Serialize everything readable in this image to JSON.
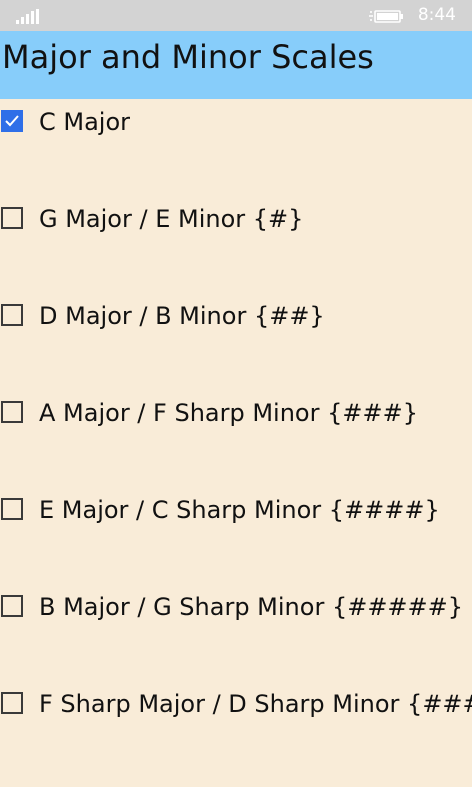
{
  "status_bar": {
    "time": "8:44",
    "signal_icon": "signal-strength-icon",
    "battery_icon": "battery-charging-icon"
  },
  "header": {
    "title": "Major and Minor Scales"
  },
  "scales": [
    {
      "label": "C Major",
      "checked": true
    },
    {
      "label": "G Major / E Minor {#}",
      "checked": false
    },
    {
      "label": "D Major / B Minor {##}",
      "checked": false
    },
    {
      "label": "A Major / F Sharp Minor {###}",
      "checked": false
    },
    {
      "label": "E Major / C Sharp Minor {####}",
      "checked": false
    },
    {
      "label": "B Major / G Sharp Minor {#####}",
      "checked": false
    },
    {
      "label": "F Sharp Major / D Sharp Minor {######}",
      "checked": false
    }
  ],
  "colors": {
    "background": "#f9ecd8",
    "title_bar": "#87cdfa",
    "status_bar": "#d3d3d3",
    "accent": "#2f6fe8"
  }
}
